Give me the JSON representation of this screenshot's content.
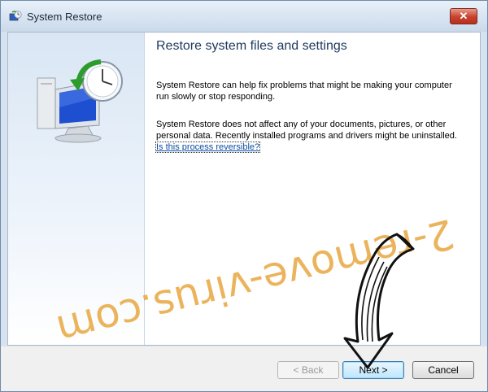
{
  "window": {
    "title": "System Restore",
    "close_label": "✕"
  },
  "content": {
    "heading": "Restore system files and settings",
    "paragraph1": "System Restore can help fix problems that might be making your computer run slowly or stop responding.",
    "paragraph2": "System Restore does not affect any of your documents, pictures, or other personal data. Recently installed programs and drivers might be uninstalled.",
    "help_link": "Is this process reversible?"
  },
  "buttons": {
    "back": "< Back",
    "next": "Next >",
    "cancel": "Cancel"
  },
  "watermark": {
    "text": "2-remove-virus.com"
  },
  "icons": {
    "title": "system-restore-icon",
    "side": "system-restore-illustration",
    "overlay": "hand-drawn-arrow-icon"
  },
  "colors": {
    "close_button": "#c7412c",
    "link": "#0b4ea2",
    "watermark": "#e8aa46"
  }
}
